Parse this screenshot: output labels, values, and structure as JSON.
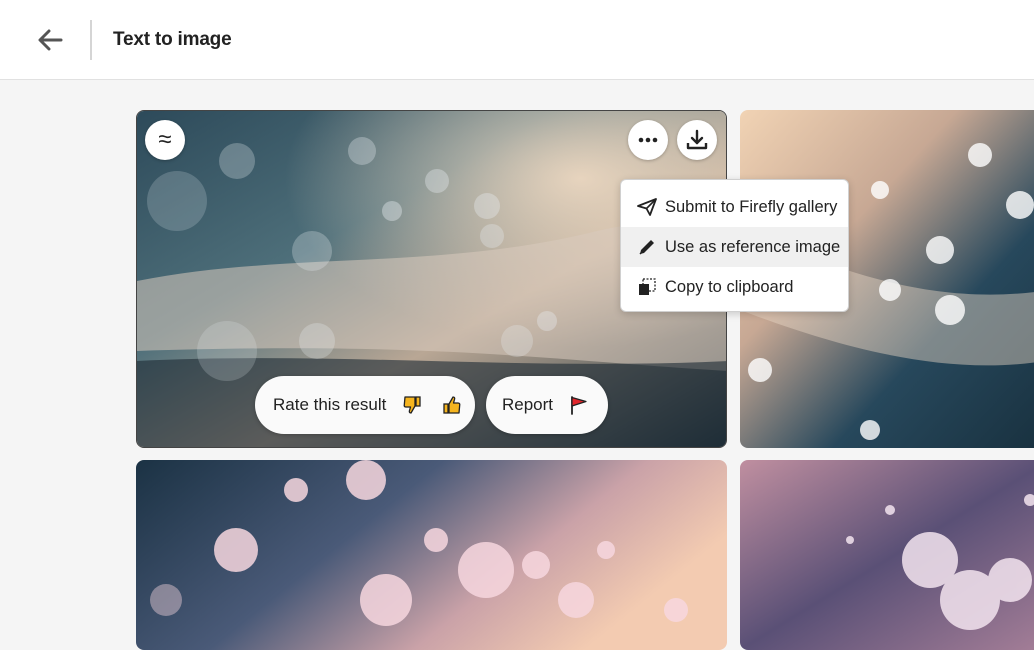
{
  "header": {
    "back_icon": "arrow-left-icon",
    "title": "Text to image"
  },
  "image_card": {
    "variation_icon": "approx-equal-icon",
    "more_icon": "more-dots-icon",
    "download_icon": "download-icon",
    "rate_label": "Rate this result",
    "thumbs_down_icon": "thumbs-down-icon",
    "thumbs_up_icon": "thumbs-up-icon",
    "report_label": "Report",
    "report_icon": "flag-icon"
  },
  "more_menu": {
    "items": [
      {
        "label": "Submit to Firefly gallery",
        "icon": "paper-plane-icon"
      },
      {
        "label": "Use as reference image",
        "icon": "pencil-icon"
      },
      {
        "label": "Copy to clipboard",
        "icon": "copy-icon"
      }
    ]
  },
  "colors": {
    "thumb_fill": "#f5b41e",
    "flag_fill": "#e0262c",
    "header_bg": "#ffffff",
    "page_bg": "#f5f5f5"
  }
}
